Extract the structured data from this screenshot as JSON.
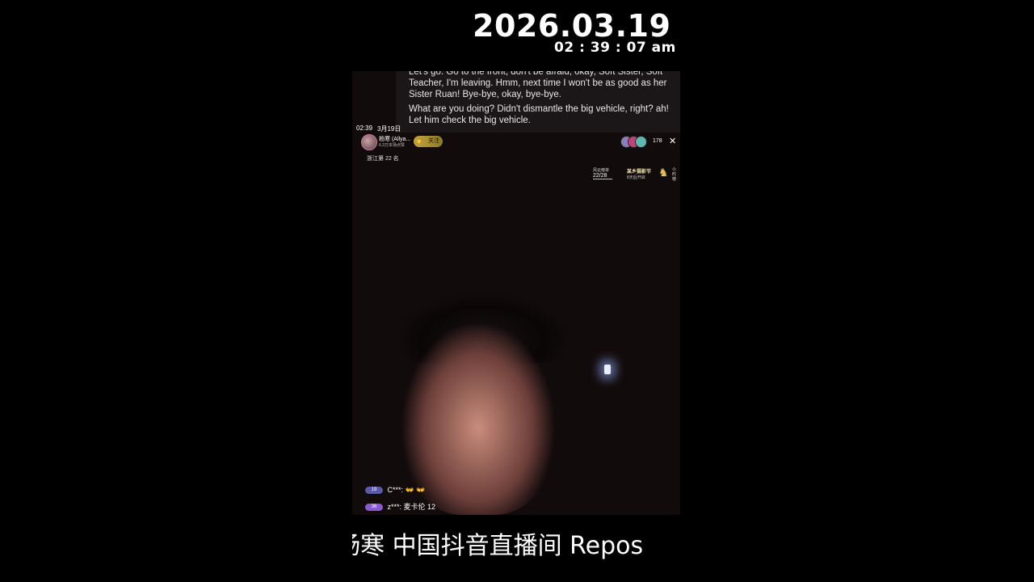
{
  "overlay": {
    "date": "2026.03.19",
    "time": "02 : 39 : 07 am"
  },
  "subtitles": {
    "line1": "Let's go. Go to the front, don't be afraid, okay, Soft Sister, Soft Teacher, I'm leaving. Hmm, next time I won't be as good as her Sister Ruan! Bye-bye, okay, bye-bye.",
    "line2": "What are you doing? Didn't dismantle the big vehicle, right? ah! Let him check the big vehicle."
  },
  "stream": {
    "status_time": "02:39",
    "status_date": "3月19日",
    "host_name": "杨寒 (Allya...",
    "host_sub": "6.3万本场点赞",
    "follow_label": "关注",
    "region": "浙江第 22 名",
    "viewer_count": "178",
    "rank_label": "风云榜单",
    "rank_value": "22/28",
    "event_title": "某乡摄影节",
    "event_sub": "8天后开启",
    "side_text": "小时榜"
  },
  "chat": [
    {
      "badge": "19",
      "text": "C***: 👐 👐"
    },
    {
      "badge": "36",
      "text": "z***: 麦卡伦 12"
    }
  ],
  "caption": {
    "text": "/杨寒 中国抖音直播间 Repos"
  },
  "colors": {
    "background": "#000000",
    "subtitle_bg": "#1c1819",
    "accent_gold": "#c7a23a"
  }
}
